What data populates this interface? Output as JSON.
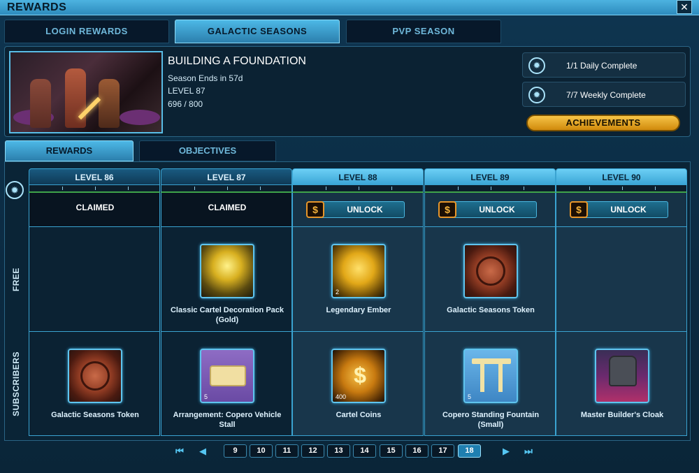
{
  "window": {
    "title": "REWARDS",
    "close_label": "✕"
  },
  "top_tabs": [
    {
      "label": "LOGIN REWARDS",
      "active": false
    },
    {
      "label": "GALACTIC SEASONS",
      "active": true
    },
    {
      "label": "PVP SEASON",
      "active": false
    }
  ],
  "season": {
    "name": "BUILDING A FOUNDATION",
    "ends": "Season Ends in 57d",
    "level": "LEVEL 87",
    "progress": "696 / 800"
  },
  "status": {
    "daily": "1/1 Daily Complete",
    "weekly": "7/7 Weekly Complete"
  },
  "achievements_label": "ACHIEVEMENTS",
  "sub_tabs": [
    {
      "label": "REWARDS",
      "active": true
    },
    {
      "label": "OBJECTIVES",
      "active": false
    }
  ],
  "row_labels": {
    "free": "FREE",
    "subscribers": "SUBSCRIBERS"
  },
  "levels": [
    {
      "label": "LEVEL 86",
      "state": "CLAIMED",
      "free": null,
      "sub": {
        "name": "Galactic Seasons Token",
        "qty": "",
        "icon": "token-icon"
      }
    },
    {
      "label": "LEVEL 87",
      "state": "CLAIMED",
      "free": {
        "name": "Classic Cartel Decoration Pack (Gold)",
        "qty": "",
        "icon": "decoration-pack-icon"
      },
      "sub": {
        "name": "Arrangement: Copero Vehicle Stall",
        "qty": "5",
        "icon": "vehicle-stall-icon"
      }
    },
    {
      "label": "LEVEL 88",
      "state": "UNLOCK",
      "free": {
        "name": "Legendary Ember",
        "qty": "2",
        "icon": "ember-icon"
      },
      "sub": {
        "name": "Cartel Coins",
        "qty": "400",
        "icon": "cartel-coins-icon"
      }
    },
    {
      "label": "LEVEL 89",
      "state": "UNLOCK",
      "free": {
        "name": "Galactic Seasons Token",
        "qty": "",
        "icon": "token-icon"
      },
      "sub": {
        "name": "Copero Standing Fountain (Small)",
        "qty": "5",
        "icon": "fountain-icon"
      }
    },
    {
      "label": "LEVEL 90",
      "state": "UNLOCK",
      "free": null,
      "sub": {
        "name": "Master Builder's Cloak",
        "qty": "",
        "icon": "cloak-icon"
      }
    }
  ],
  "pager": {
    "first": "⏮",
    "prev": "◀",
    "next": "▶",
    "last": "⏭",
    "pages": [
      "9",
      "10",
      "11",
      "12",
      "13",
      "14",
      "15",
      "16",
      "17",
      "18"
    ],
    "current": "18"
  },
  "colors": {
    "accent": "#3aa3d1",
    "achievement_gold": "#f7c447",
    "coin_orange": "#e8962a"
  }
}
